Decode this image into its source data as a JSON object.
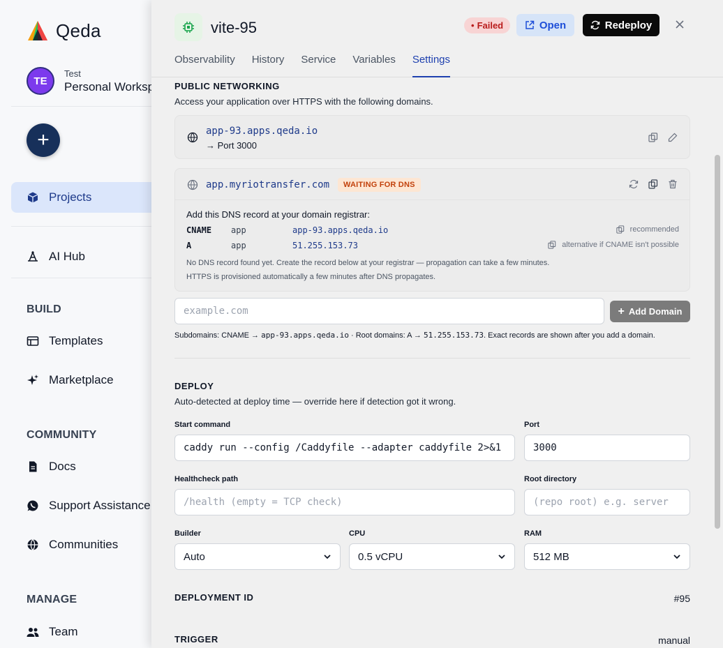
{
  "sidebar": {
    "logo": "Qeda",
    "workspace": {
      "avatar": "TE",
      "sub": "Test",
      "name": "Personal Workspace"
    },
    "items": [
      {
        "label": "Projects",
        "icon": "box-icon",
        "active": true
      },
      {
        "label": "AI Hub",
        "icon": "ai-hub-icon"
      }
    ],
    "sections": [
      {
        "title": "BUILD",
        "items": [
          {
            "label": "Templates",
            "icon": "templates-icon"
          },
          {
            "label": "Marketplace",
            "icon": "sparkle-icon"
          }
        ]
      },
      {
        "title": "COMMUNITY",
        "items": [
          {
            "label": "Docs",
            "icon": "docs-icon"
          },
          {
            "label": "Support Assistance",
            "icon": "whatsapp-icon"
          },
          {
            "label": "Communities",
            "icon": "globe-icon"
          }
        ]
      },
      {
        "title": "MANAGE",
        "items": [
          {
            "label": "Team",
            "icon": "team-icon"
          }
        ]
      }
    ]
  },
  "drawer": {
    "service_name": "vite-95",
    "status": "Failed",
    "open_label": "Open",
    "redeploy_label": "Redeploy",
    "tabs": [
      "Observability",
      "History",
      "Service",
      "Variables",
      "Settings"
    ],
    "active_tab": "Settings",
    "networking": {
      "title": "PUBLIC NETWORKING",
      "desc": "Access your application over HTTPS with the following domains.",
      "primary_domain": "app-93.apps.qeda.io",
      "primary_port": "→ Port 3000",
      "custom_domain": "app.myriotransfer.com",
      "custom_status": "WAITING FOR DNS",
      "dns_intro": "Add this DNS record at your domain registrar:",
      "records": [
        {
          "type": "CNAME",
          "name": "app",
          "value": "app-93.apps.qeda.io",
          "note": "recommended"
        },
        {
          "type": "A",
          "name": "app",
          "value": "51.255.153.73",
          "note": "alternative if CNAME isn't possible"
        }
      ],
      "note1": "No DNS record found yet. Create the record below at your registrar — propagation can take a few minutes.",
      "note2": "HTTPS is provisioned automatically a few minutes after DNS propagates.",
      "domain_placeholder": "example.com",
      "add_domain_label": "Add Domain",
      "hint_a": "Subdomains: CNAME → ",
      "hint_a_mono": "app-93.apps.qeda.io",
      "hint_b": " · Root domains: A → ",
      "hint_b_mono": "51.255.153.73",
      "hint_c": ". Exact records are shown after you add a domain."
    },
    "deploy": {
      "title": "DEPLOY",
      "desc": "Auto-detected at deploy time — override here if detection got it wrong.",
      "start_label": "Start command",
      "start_value": "caddy run --config /Caddyfile --adapter caddyfile 2>&1",
      "port_label": "Port",
      "port_value": "3000",
      "health_label": "Healthcheck path",
      "health_placeholder": "/health (empty = TCP check)",
      "root_label": "Root directory",
      "root_placeholder": "(repo root) e.g. server",
      "builder_label": "Builder",
      "builder_value": "Auto",
      "cpu_label": "CPU",
      "cpu_value": "0.5 vCPU",
      "ram_label": "RAM",
      "ram_value": "512 MB"
    },
    "deployment_id_label": "DEPLOYMENT ID",
    "deployment_id": "#95",
    "trigger_label": "TRIGGER",
    "trigger_value": "manual"
  }
}
